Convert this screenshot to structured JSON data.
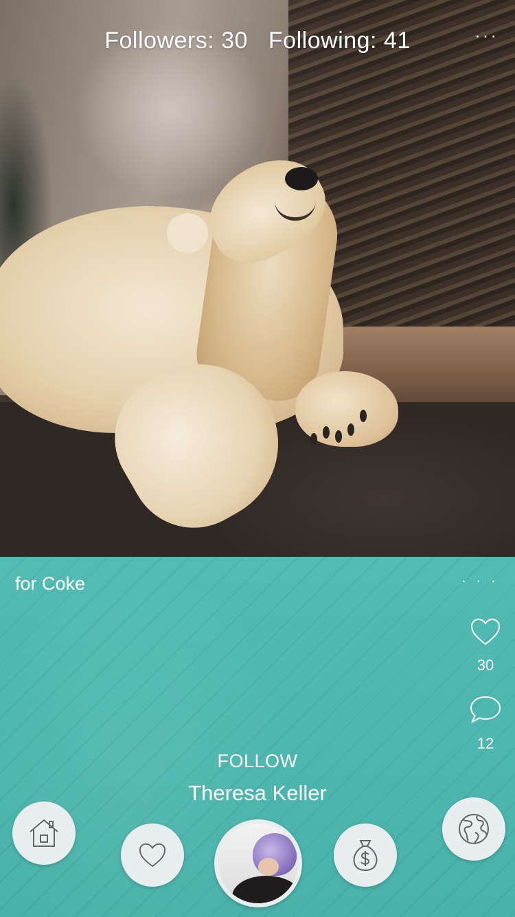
{
  "profile": {
    "followers_text": "Followers: 30",
    "following_text": "Following: 41",
    "more_label": "···"
  },
  "post": {
    "caption": "for Coke",
    "more_label": "· · ·",
    "likes": "30",
    "comments": "12",
    "follow_label": "FOLLOW",
    "author_name": "Theresa Keller"
  },
  "nav": {
    "items": [
      {
        "name": "home",
        "icon": "house-icon"
      },
      {
        "name": "favorites",
        "icon": "heart-icon"
      },
      {
        "name": "profile",
        "icon": "avatar"
      },
      {
        "name": "money",
        "icon": "money-bag-icon"
      },
      {
        "name": "explore",
        "icon": "globe-icon"
      }
    ]
  },
  "colors": {
    "panel_teal": "#4bb3ab",
    "button_bg": "#e8eeee",
    "icon_stroke": "#5c6667"
  }
}
